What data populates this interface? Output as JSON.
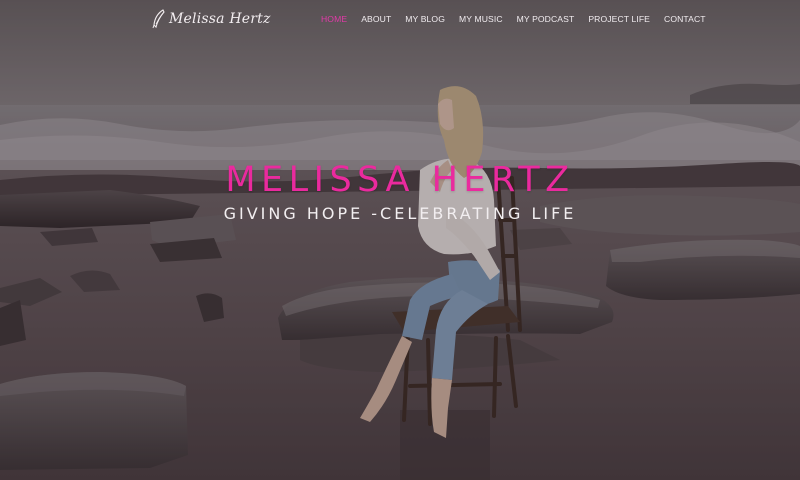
{
  "header": {
    "logo_text": "Melissa Hertz",
    "logo_icon": "feather-icon",
    "nav": [
      {
        "label": "HOME",
        "active": true
      },
      {
        "label": "ABOUT",
        "active": false
      },
      {
        "label": "MY BLOG",
        "active": false
      },
      {
        "label": "MY MUSIC",
        "active": false
      },
      {
        "label": "MY PODCAST",
        "active": false
      },
      {
        "label": "PROJECT LIFE",
        "active": false
      },
      {
        "label": "CONTACT",
        "active": false
      }
    ]
  },
  "hero": {
    "title": "MELISSA HERTZ",
    "subtitle": "GIVING HOPE -CELEBRATING LIFE"
  },
  "colors": {
    "accent": "#ea2a9e",
    "nav_text": "#f1ecef"
  }
}
